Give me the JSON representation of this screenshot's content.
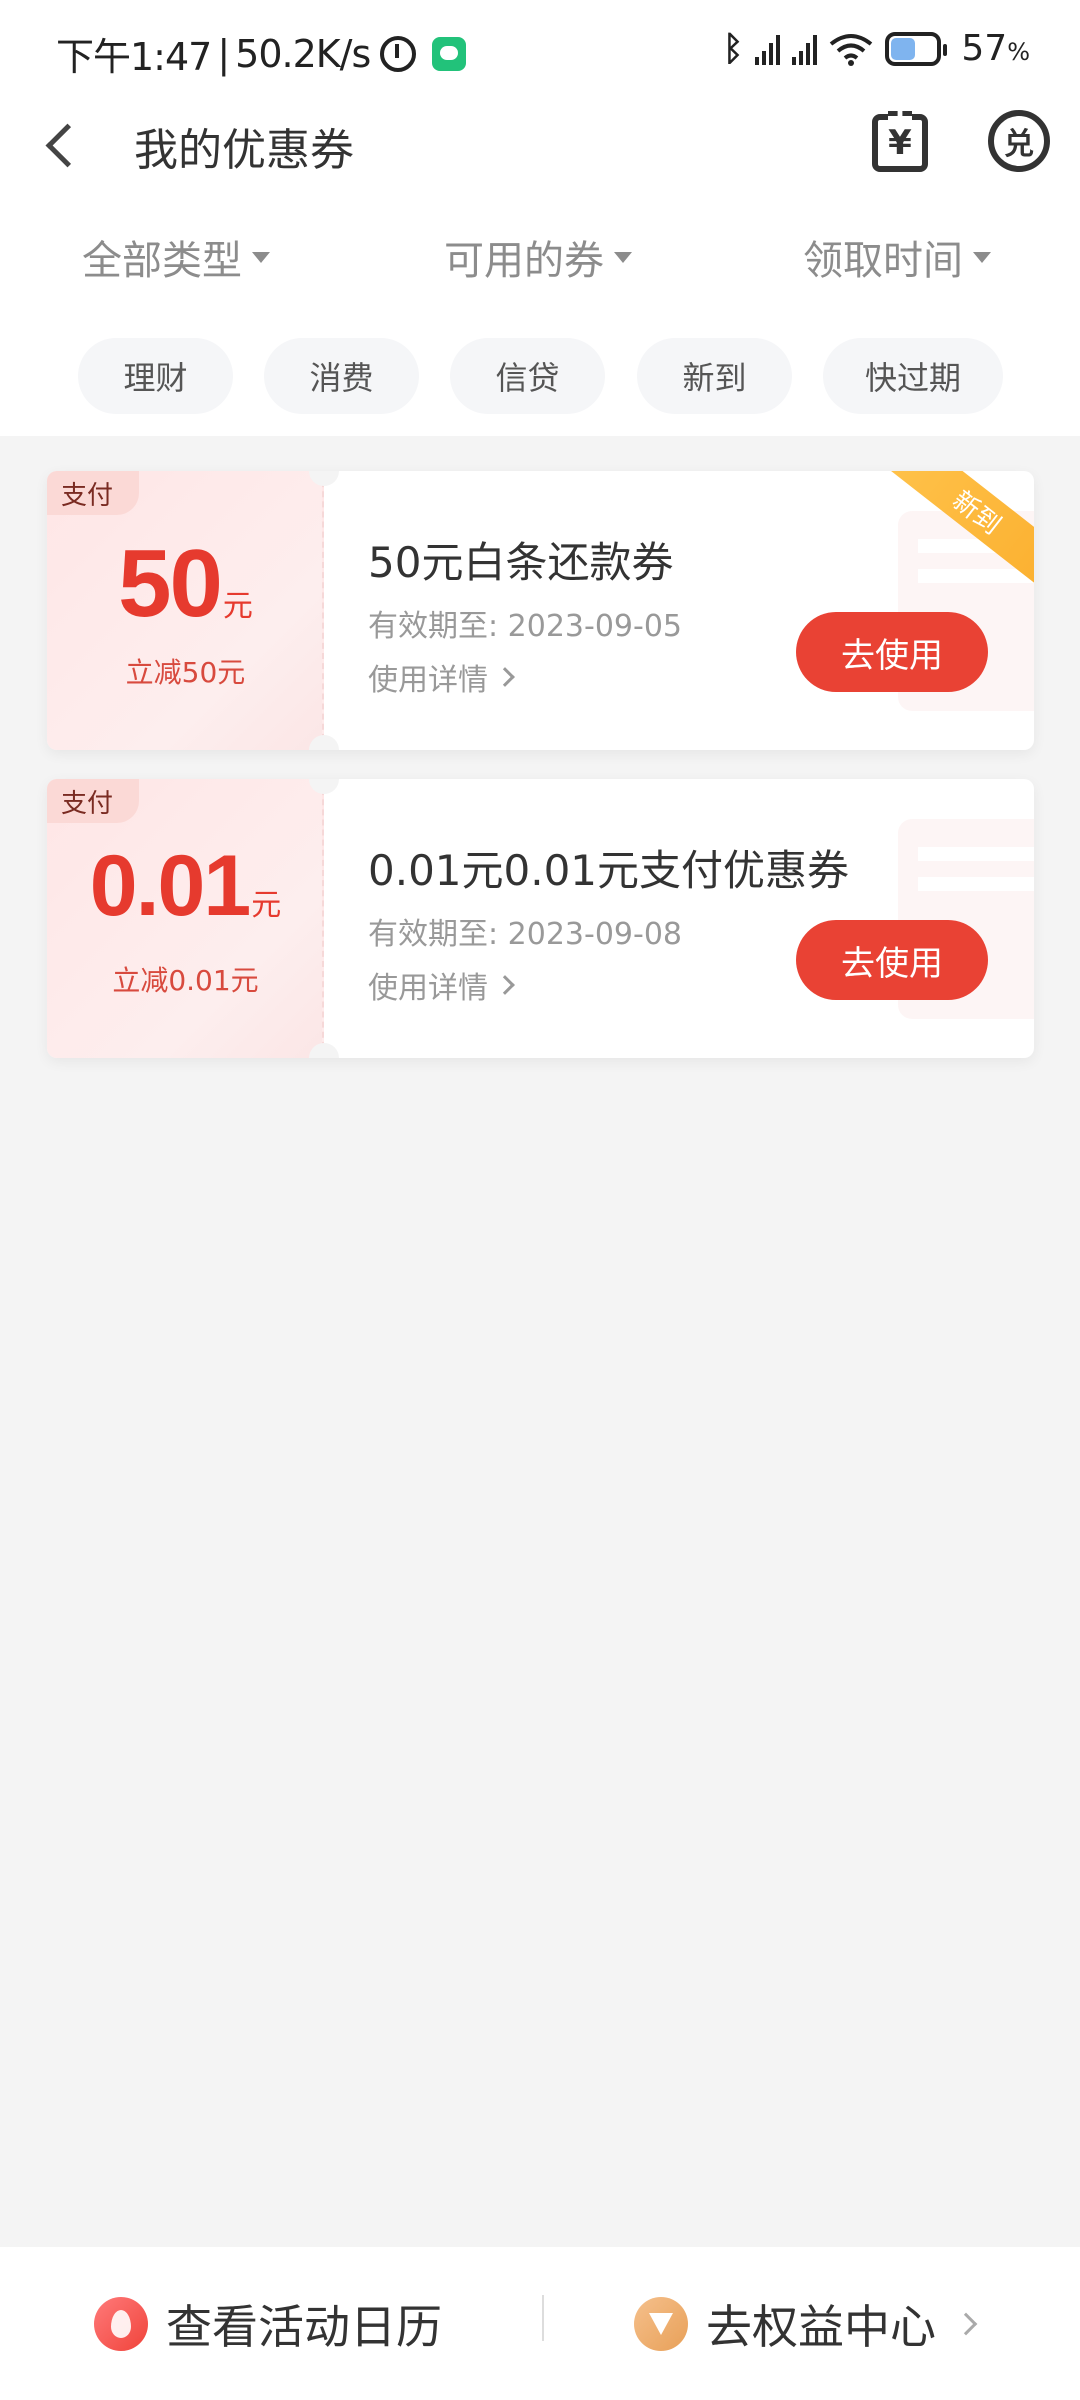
{
  "status_bar": {
    "time": "下午1:47",
    "separator": "|",
    "net_speed": "50.2K/s",
    "battery_percent": "57",
    "battery_unit": "%"
  },
  "navbar": {
    "title": "我的优惠券",
    "bill_icon_glyph": "¥",
    "exchange_icon_glyph": "兑"
  },
  "filters": [
    {
      "label": "全部类型"
    },
    {
      "label": "可用的券"
    },
    {
      "label": "领取时间"
    }
  ],
  "chips": [
    {
      "label": "理财"
    },
    {
      "label": "消费"
    },
    {
      "label": "信贷"
    },
    {
      "label": "新到"
    },
    {
      "label": "快过期"
    }
  ],
  "coupons": [
    {
      "category": "支付",
      "amount": "50",
      "unit": "元",
      "subtitle": "立减50元",
      "title": "50元白条还款券",
      "expiry": "有效期至: 2023-09-05",
      "detail_label": "使用详情",
      "button_label": "去使用",
      "ribbon": "新到"
    },
    {
      "category": "支付",
      "amount": "0.01",
      "unit": "元",
      "subtitle": "立减0.01元",
      "title": "0.01元0.01元支付优惠券",
      "expiry": "有效期至: 2023-09-08",
      "detail_label": "使用详情",
      "button_label": "去使用"
    }
  ],
  "bottom_bar": {
    "calendar_label": "查看活动日历",
    "benefits_label": "去权益中心"
  },
  "colors": {
    "accent_red": "#e94234",
    "ribbon_orange": "#fbb030"
  }
}
